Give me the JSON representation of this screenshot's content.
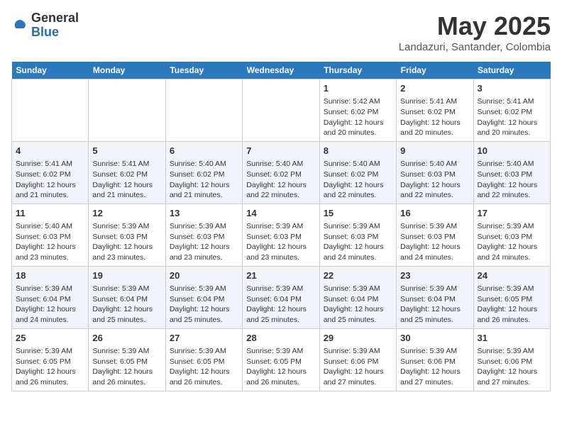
{
  "logo": {
    "general": "General",
    "blue": "Blue"
  },
  "title": "May 2025",
  "location": "Landazuri, Santander, Colombia",
  "weekdays": [
    "Sunday",
    "Monday",
    "Tuesday",
    "Wednesday",
    "Thursday",
    "Friday",
    "Saturday"
  ],
  "weeks": [
    [
      {
        "day": "",
        "content": ""
      },
      {
        "day": "",
        "content": ""
      },
      {
        "day": "",
        "content": ""
      },
      {
        "day": "",
        "content": ""
      },
      {
        "day": "1",
        "content": "Sunrise: 5:42 AM\nSunset: 6:02 PM\nDaylight: 12 hours\nand 20 minutes."
      },
      {
        "day": "2",
        "content": "Sunrise: 5:41 AM\nSunset: 6:02 PM\nDaylight: 12 hours\nand 20 minutes."
      },
      {
        "day": "3",
        "content": "Sunrise: 5:41 AM\nSunset: 6:02 PM\nDaylight: 12 hours\nand 20 minutes."
      }
    ],
    [
      {
        "day": "4",
        "content": "Sunrise: 5:41 AM\nSunset: 6:02 PM\nDaylight: 12 hours\nand 21 minutes."
      },
      {
        "day": "5",
        "content": "Sunrise: 5:41 AM\nSunset: 6:02 PM\nDaylight: 12 hours\nand 21 minutes."
      },
      {
        "day": "6",
        "content": "Sunrise: 5:40 AM\nSunset: 6:02 PM\nDaylight: 12 hours\nand 21 minutes."
      },
      {
        "day": "7",
        "content": "Sunrise: 5:40 AM\nSunset: 6:02 PM\nDaylight: 12 hours\nand 22 minutes."
      },
      {
        "day": "8",
        "content": "Sunrise: 5:40 AM\nSunset: 6:02 PM\nDaylight: 12 hours\nand 22 minutes."
      },
      {
        "day": "9",
        "content": "Sunrise: 5:40 AM\nSunset: 6:03 PM\nDaylight: 12 hours\nand 22 minutes."
      },
      {
        "day": "10",
        "content": "Sunrise: 5:40 AM\nSunset: 6:03 PM\nDaylight: 12 hours\nand 22 minutes."
      }
    ],
    [
      {
        "day": "11",
        "content": "Sunrise: 5:40 AM\nSunset: 6:03 PM\nDaylight: 12 hours\nand 23 minutes."
      },
      {
        "day": "12",
        "content": "Sunrise: 5:39 AM\nSunset: 6:03 PM\nDaylight: 12 hours\nand 23 minutes."
      },
      {
        "day": "13",
        "content": "Sunrise: 5:39 AM\nSunset: 6:03 PM\nDaylight: 12 hours\nand 23 minutes."
      },
      {
        "day": "14",
        "content": "Sunrise: 5:39 AM\nSunset: 6:03 PM\nDaylight: 12 hours\nand 23 minutes."
      },
      {
        "day": "15",
        "content": "Sunrise: 5:39 AM\nSunset: 6:03 PM\nDaylight: 12 hours\nand 24 minutes."
      },
      {
        "day": "16",
        "content": "Sunrise: 5:39 AM\nSunset: 6:03 PM\nDaylight: 12 hours\nand 24 minutes."
      },
      {
        "day": "17",
        "content": "Sunrise: 5:39 AM\nSunset: 6:03 PM\nDaylight: 12 hours\nand 24 minutes."
      }
    ],
    [
      {
        "day": "18",
        "content": "Sunrise: 5:39 AM\nSunset: 6:04 PM\nDaylight: 12 hours\nand 24 minutes."
      },
      {
        "day": "19",
        "content": "Sunrise: 5:39 AM\nSunset: 6:04 PM\nDaylight: 12 hours\nand 25 minutes."
      },
      {
        "day": "20",
        "content": "Sunrise: 5:39 AM\nSunset: 6:04 PM\nDaylight: 12 hours\nand 25 minutes."
      },
      {
        "day": "21",
        "content": "Sunrise: 5:39 AM\nSunset: 6:04 PM\nDaylight: 12 hours\nand 25 minutes."
      },
      {
        "day": "22",
        "content": "Sunrise: 5:39 AM\nSunset: 6:04 PM\nDaylight: 12 hours\nand 25 minutes."
      },
      {
        "day": "23",
        "content": "Sunrise: 5:39 AM\nSunset: 6:04 PM\nDaylight: 12 hours\nand 25 minutes."
      },
      {
        "day": "24",
        "content": "Sunrise: 5:39 AM\nSunset: 6:05 PM\nDaylight: 12 hours\nand 26 minutes."
      }
    ],
    [
      {
        "day": "25",
        "content": "Sunrise: 5:39 AM\nSunset: 6:05 PM\nDaylight: 12 hours\nand 26 minutes."
      },
      {
        "day": "26",
        "content": "Sunrise: 5:39 AM\nSunset: 6:05 PM\nDaylight: 12 hours\nand 26 minutes."
      },
      {
        "day": "27",
        "content": "Sunrise: 5:39 AM\nSunset: 6:05 PM\nDaylight: 12 hours\nand 26 minutes."
      },
      {
        "day": "28",
        "content": "Sunrise: 5:39 AM\nSunset: 6:05 PM\nDaylight: 12 hours\nand 26 minutes."
      },
      {
        "day": "29",
        "content": "Sunrise: 5:39 AM\nSunset: 6:06 PM\nDaylight: 12 hours\nand 27 minutes."
      },
      {
        "day": "30",
        "content": "Sunrise: 5:39 AM\nSunset: 6:06 PM\nDaylight: 12 hours\nand 27 minutes."
      },
      {
        "day": "31",
        "content": "Sunrise: 5:39 AM\nSunset: 6:06 PM\nDaylight: 12 hours\nand 27 minutes."
      }
    ]
  ]
}
